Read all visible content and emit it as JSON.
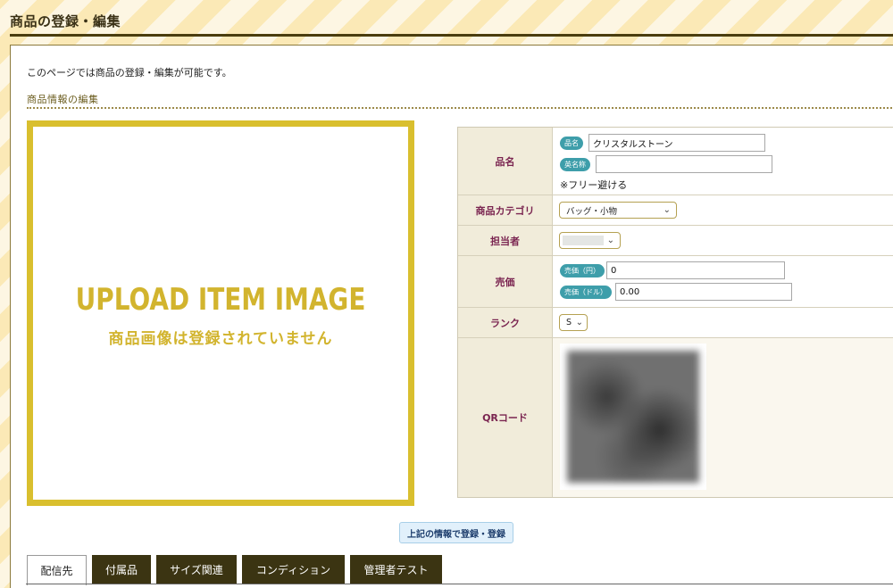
{
  "header": {
    "title": "商品の登録・編集"
  },
  "intro": "このページでは商品の登録・編集が可能です。",
  "section": {
    "title": "商品情報の編集"
  },
  "upload": {
    "main": "UPLOAD ITEM IMAGE",
    "sub": "商品画像は登録されていません"
  },
  "form": {
    "name": {
      "label": "品名",
      "name_pill": "品名",
      "name_value": "クリスタルストーン",
      "english_pill": "英名称",
      "english_value": "",
      "note": "※フリー避ける"
    },
    "category": {
      "label": "商品カテゴリ",
      "selected": "バッグ・小物"
    },
    "person": {
      "label": "担当者",
      "selected": ""
    },
    "price": {
      "label": "売価",
      "yen_pill": "売価（円）",
      "yen_value": "0",
      "usd_pill": "売価（ドル）",
      "usd_value": "0.00"
    },
    "rank": {
      "label": "ランク",
      "selected": "S"
    },
    "qr": {
      "label": "QRコード"
    }
  },
  "submit_label": "上記の情報で登録・登録",
  "tabs": [
    {
      "label": "配信先",
      "active": true
    },
    {
      "label": "付属品",
      "active": false
    },
    {
      "label": "サイズ関連",
      "active": false
    },
    {
      "label": "コンディション",
      "active": false
    },
    {
      "label": "管理者テスト",
      "active": false
    }
  ],
  "colors": {
    "accent_yellow": "#d9bf2e",
    "header_rule": "#4a3d0e",
    "label_text": "#7a2450",
    "pill": "#3e9eaa",
    "tab_dark": "#3b3412"
  },
  "icons": {
    "select_chevron": "chevron-down-icon"
  }
}
